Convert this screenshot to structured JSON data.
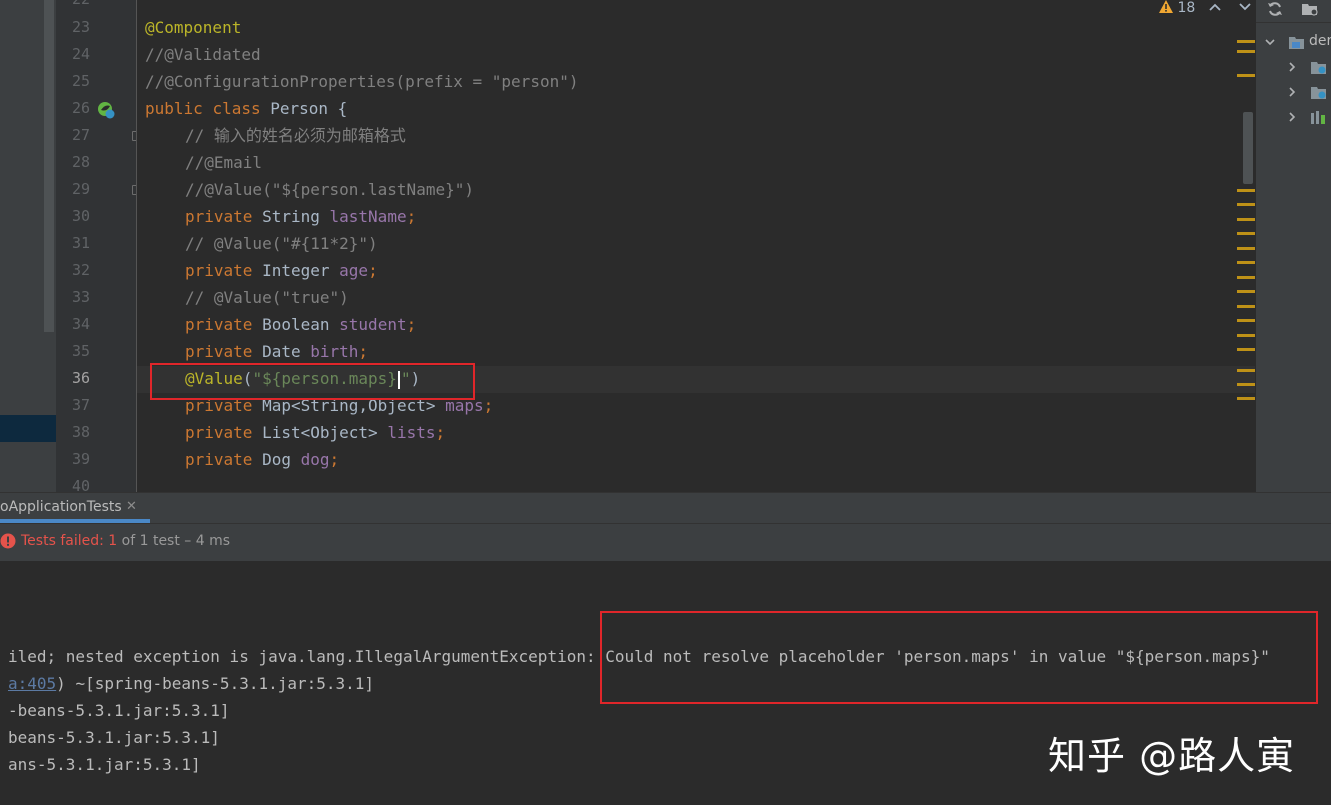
{
  "editor": {
    "line_numbers": [
      "22",
      "23",
      "24",
      "25",
      "26",
      "27",
      "28",
      "29",
      "30",
      "31",
      "32",
      "33",
      "34",
      "35",
      "36",
      "37",
      "38",
      "39",
      "40"
    ],
    "lines": {
      "l23": "@Component",
      "l24": "//@Validated",
      "l25": "//@ConfigurationProperties(prefix = \"person\")",
      "l26_kw1": "public",
      "l26_kw2": "class",
      "l26_rest": "Person {",
      "l27": "// 输入的姓名必须为邮箱格式",
      "l28": "//@Email",
      "l29": "//@Value(\"${person.lastName}\")",
      "l30_kw": "private",
      "l30_type": "String",
      "l30_field": "lastName",
      "l31": "// @Value(\"#{11*2}\")",
      "l32_kw": "private",
      "l32_type": "Integer",
      "l32_field": "age",
      "l33": "// @Value(\"true\")",
      "l34_kw": "private",
      "l34_type": "Boolean",
      "l34_field": "student",
      "l35_kw": "private",
      "l35_type": "Date",
      "l35_field": "birth",
      "l36_ann": "@Value",
      "l36_open": "(",
      "l36_str_a": "\"${person.maps}",
      "l36_str_b": "\"",
      "l36_close": ")",
      "l37_kw": "private",
      "l37_type": "Map<String,Object>",
      "l37_field": "maps",
      "l38_kw": "private",
      "l38_type": "List<Object>",
      "l38_field": "lists",
      "l39_kw": "private",
      "l39_type": "Dog",
      "l39_field": "dog",
      "semicolon": ";"
    },
    "warnings_count": "18"
  },
  "project_panel": {
    "root_label": "der"
  },
  "run_panel": {
    "tab_label": "oApplicationTests",
    "tab_close": "✕",
    "status_failed": "Tests failed: ",
    "status_failed_count": "1",
    "status_rest": " of 1 test – 4 ms",
    "console": {
      "line1": "iled; nested exception is java.lang.IllegalArgumentException: Could not resolve placeholder 'person.maps' in value \"${person.maps}\"",
      "line2_link": "a:405",
      "line2_rest": ") ~[spring-beans-5.3.1.jar:5.3.1]",
      "line3": "-beans-5.3.1.jar:5.3.1]",
      "line4": "beans-5.3.1.jar:5.3.1]",
      "line5": "ans-5.3.1.jar:5.3.1]"
    }
  },
  "watermark": "知乎 @路人寅",
  "colors": {
    "keyword": "#cc7832",
    "annotation": "#bbb529",
    "comment": "#808080",
    "string": "#6a8759",
    "field": "#9876aa",
    "error_red": "#e0262a",
    "warning": "#be9117"
  }
}
